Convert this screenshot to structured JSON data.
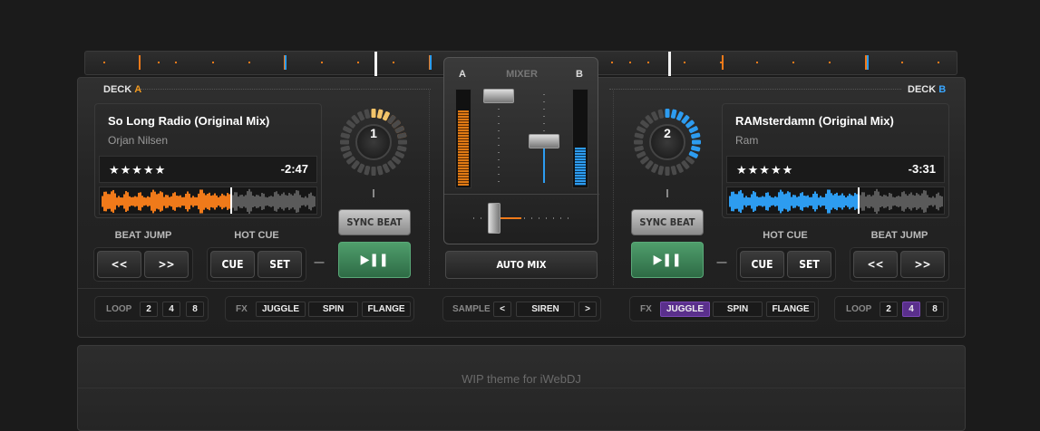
{
  "deck_a": {
    "label": "DECK",
    "letter": "A",
    "title": "So Long Radio (Original Mix)",
    "artist": "Orjan Nilsen",
    "rating": "★★★★★",
    "time": "-2:47",
    "knob_number": "1",
    "accent": "#f07a1a",
    "progress": 0.6
  },
  "deck_b": {
    "label": "DECK",
    "letter": "B",
    "title": "RAMsterdamn (Original Mix)",
    "artist": "Ram",
    "rating": "★★★★★",
    "time": "-3:31",
    "knob_number": "2",
    "accent": "#2d9cf0",
    "progress": 0.6
  },
  "controls": {
    "sync_beat": "SYNC BEAT",
    "beat_jump": "BEAT JUMP",
    "hot_cue": "HOT CUE",
    "back": "<<",
    "forward": ">>",
    "cue": "CUE",
    "set": "SET",
    "play_pause": "▶❚❚",
    "dash": "—"
  },
  "mixer": {
    "label": "MIXER",
    "channel_a": "A",
    "channel_b": "B",
    "auto_mix": "AUTO MIX",
    "level_a": 0.8,
    "level_b": 0.4
  },
  "bottom_bar": {
    "loop": "LOOP",
    "loop_values_a": [
      "2",
      "4",
      "8"
    ],
    "loop_values_b": [
      "2",
      "4",
      "8"
    ],
    "loop_selected_b": "4",
    "fx": "FX",
    "fx_items": [
      "JUGGLE",
      "SPIN",
      "FLANGE"
    ],
    "fx_selected_b": "JUGGLE",
    "sample": "SAMPLE",
    "sample_prev": "<",
    "sample_value": "SIREN",
    "sample_next": ">"
  },
  "footer": {
    "text": "WIP theme for iWebDJ"
  },
  "colors": {
    "orange": "#f07a1a",
    "blue": "#2d9cf0",
    "purple": "#5a2f8c",
    "green": "#3f8a5a"
  }
}
